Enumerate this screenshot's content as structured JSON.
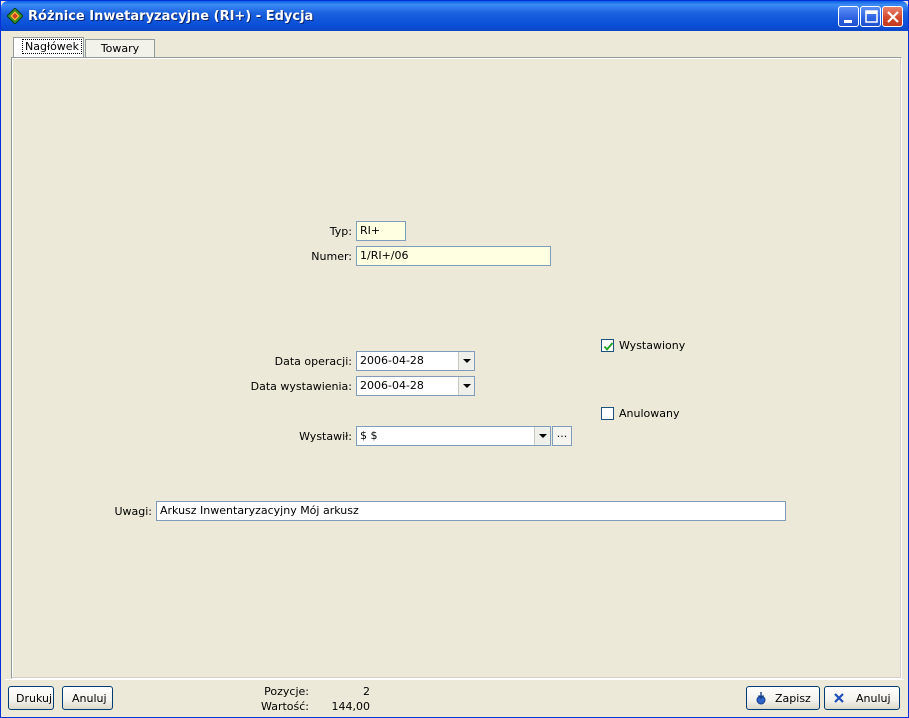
{
  "window": {
    "title": "Różnice Inwetaryzacyjne (RI+) - Edycja"
  },
  "tabs": [
    {
      "label": "Nagłówek",
      "active": true
    },
    {
      "label": "Towary",
      "active": false
    }
  ],
  "form": {
    "typ_label": "Typ:",
    "typ_value": "RI+",
    "numer_label": "Numer:",
    "numer_value": "1/RI+/06",
    "data_operacji_label": "Data operacji:",
    "data_operacji_value": "2006-04-28",
    "data_wystawienia_label": "Data wystawienia:",
    "data_wystawienia_value": "2006-04-28",
    "wystawil_label": "Wystawił:",
    "wystawil_value": "$ $",
    "wystawil_button": "...",
    "wystawiony_label": "Wystawiony",
    "wystawiony_checked": true,
    "anulowany_label": "Anulowany",
    "anulowany_checked": false,
    "uwagi_label": "Uwagi:",
    "uwagi_value": "Arkusz Inwentaryzacyjny Mój arkusz"
  },
  "footer": {
    "drukuj_label": "Drukuj",
    "anuluj_left_label": "Anuluj",
    "pozycje_label": "Pozycje:",
    "pozycje_value": "2",
    "wartosc_label": "Wartość:",
    "wartosc_value": "144,00",
    "zapisz_label": "Zapisz",
    "anuluj_right_label": "Anuluj"
  },
  "colors": {
    "titlebar": "#0A4FD8",
    "highlight_field": "#FFFFE1",
    "close_button": "#D2452A"
  },
  "icons": {
    "app": "app-diamond-icon",
    "minimize": "minimize-icon",
    "maximize": "maximize-icon",
    "close": "close-icon",
    "save": "save-icon",
    "cancel": "cancel-x-icon"
  }
}
